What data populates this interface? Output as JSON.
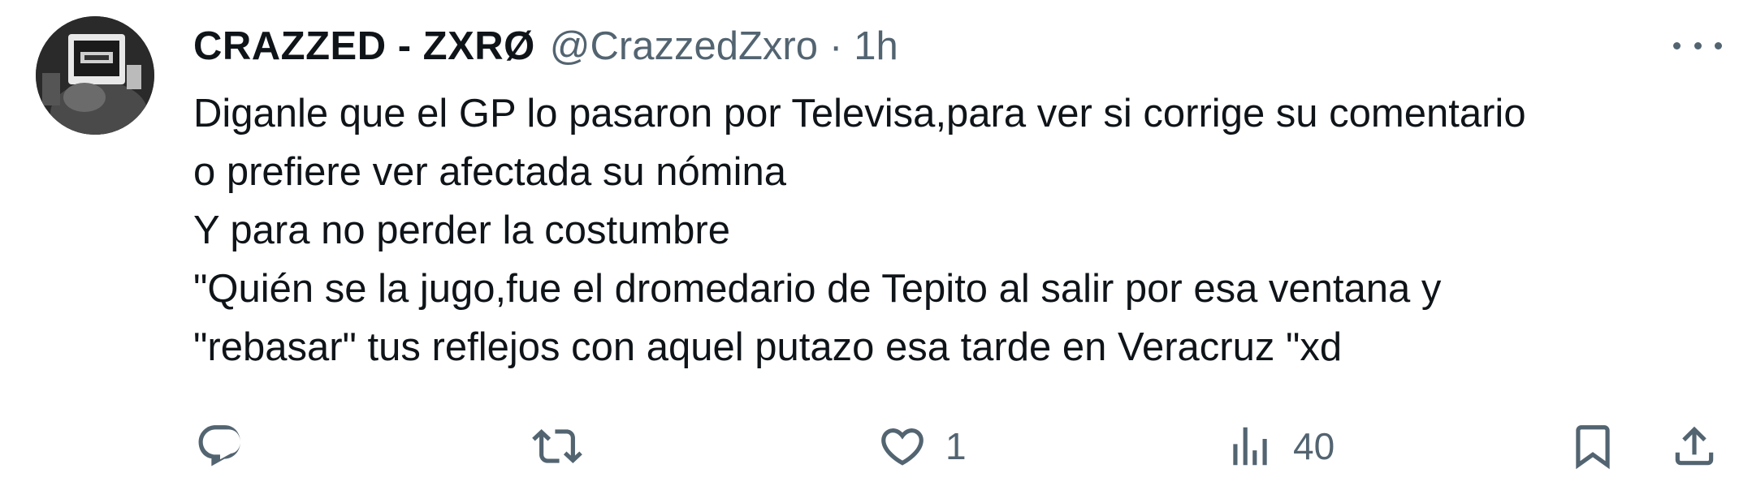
{
  "tweet": {
    "author": {
      "display_name": "CRAZZED - ZXRØ",
      "handle": "@CrazzedZxro",
      "separator": "·",
      "time": "1h",
      "avatar_icon": "profile-avatar"
    },
    "more_icon": "more-horizontal-icon",
    "text_lines": [
      "Diganle que el GP lo pasaron por Televisa,para ver si corrige su comentario",
      "o prefiere ver afectada su nómina",
      "Y para no perder la costumbre",
      "\"Quién se la jugo,fue el dromedario de Tepito al salir por esa ventana y",
      "\"rebasar\" tus reflejos con aquel putazo esa tarde en Veracruz \"xd"
    ],
    "actions": {
      "reply": {
        "icon": "reply-icon",
        "count": ""
      },
      "retweet": {
        "icon": "retweet-icon",
        "count": ""
      },
      "like": {
        "icon": "heart-icon",
        "count": "1"
      },
      "views": {
        "icon": "views-icon",
        "count": "40"
      },
      "bookmark": {
        "icon": "bookmark-icon"
      },
      "share": {
        "icon": "share-icon"
      }
    },
    "colors": {
      "text": "#0f1419",
      "secondary": "#536471",
      "background": "#ffffff"
    }
  }
}
